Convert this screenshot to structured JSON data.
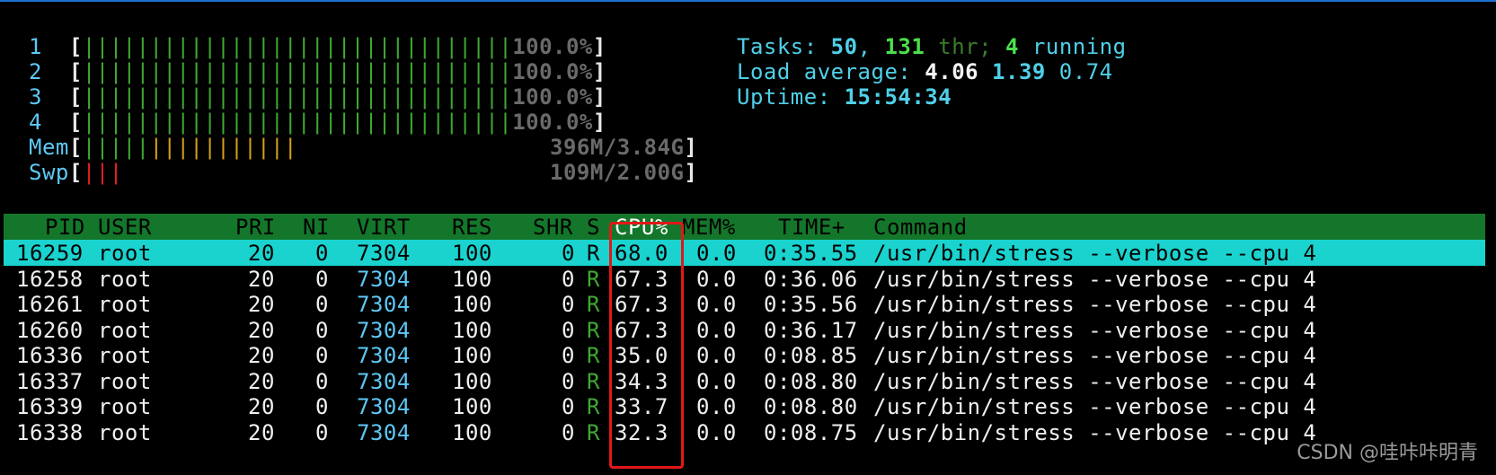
{
  "meters": {
    "cpu": [
      {
        "id": "1",
        "bars": "||||||||||||||||||||||||||||||||",
        "value": "100.0%"
      },
      {
        "id": "2",
        "bars": "||||||||||||||||||||||||||||||||",
        "value": "100.0%"
      },
      {
        "id": "3",
        "bars": "||||||||||||||||||||||||||||||||",
        "value": "100.0%"
      },
      {
        "id": "4",
        "bars": "||||||||||||||||||||||||||||||||",
        "value": "100.0%"
      }
    ],
    "mem": {
      "label": "Mem",
      "green_bars": "|||||",
      "orange_bars": "|||||||||||",
      "value": "396M/3.84G"
    },
    "swp": {
      "label": "Swp",
      "red_bars": "|||",
      "value": "109M/2.00G"
    },
    "open_bracket": "[",
    "close_bracket": "]"
  },
  "summary": {
    "tasks_label": "Tasks: ",
    "tasks": "50",
    "comma": ", ",
    "thr_count": "131",
    "thr_label": " thr; ",
    "running_count": "4",
    "running_label": " running",
    "load_label": "Load average: ",
    "load1": "4.06",
    "load5": "1.39",
    "load15": "0.74",
    "uptime_label": "Uptime: ",
    "uptime": "15:54:34"
  },
  "table": {
    "columns": [
      "PID",
      "USER",
      "PRI",
      "NI",
      "VIRT",
      "RES",
      "SHR",
      "S",
      "CPU%",
      "MEM%",
      "TIME+",
      "Command"
    ],
    "rows": [
      {
        "pid": "16259",
        "user": "root",
        "pri": "20",
        "ni": "0",
        "virt": "7304",
        "res": "100",
        "shr": "0",
        "s": "R",
        "cpu": "68.0",
        "mem": "0.0",
        "time": "0:35.55",
        "cmd": "/usr/bin/stress --verbose --cpu 4",
        "selected": true
      },
      {
        "pid": "16258",
        "user": "root",
        "pri": "20",
        "ni": "0",
        "virt": "7304",
        "res": "100",
        "shr": "0",
        "s": "R",
        "cpu": "67.3",
        "mem": "0.0",
        "time": "0:36.06",
        "cmd": "/usr/bin/stress --verbose --cpu 4"
      },
      {
        "pid": "16261",
        "user": "root",
        "pri": "20",
        "ni": "0",
        "virt": "7304",
        "res": "100",
        "shr": "0",
        "s": "R",
        "cpu": "67.3",
        "mem": "0.0",
        "time": "0:35.56",
        "cmd": "/usr/bin/stress --verbose --cpu 4"
      },
      {
        "pid": "16260",
        "user": "root",
        "pri": "20",
        "ni": "0",
        "virt": "7304",
        "res": "100",
        "shr": "0",
        "s": "R",
        "cpu": "67.3",
        "mem": "0.0",
        "time": "0:36.17",
        "cmd": "/usr/bin/stress --verbose --cpu 4"
      },
      {
        "pid": "16336",
        "user": "root",
        "pri": "20",
        "ni": "0",
        "virt": "7304",
        "res": "100",
        "shr": "0",
        "s": "R",
        "cpu": "35.0",
        "mem": "0.0",
        "time": "0:08.85",
        "cmd": "/usr/bin/stress --verbose --cpu 4"
      },
      {
        "pid": "16337",
        "user": "root",
        "pri": "20",
        "ni": "0",
        "virt": "7304",
        "res": "100",
        "shr": "0",
        "s": "R",
        "cpu": "34.3",
        "mem": "0.0",
        "time": "0:08.80",
        "cmd": "/usr/bin/stress --verbose --cpu 4"
      },
      {
        "pid": "16339",
        "user": "root",
        "pri": "20",
        "ni": "0",
        "virt": "7304",
        "res": "100",
        "shr": "0",
        "s": "R",
        "cpu": "33.7",
        "mem": "0.0",
        "time": "0:08.80",
        "cmd": "/usr/bin/stress --verbose --cpu 4"
      },
      {
        "pid": "16338",
        "user": "root",
        "pri": "20",
        "ni": "0",
        "virt": "7304",
        "res": "100",
        "shr": "0",
        "s": "R",
        "cpu": "32.3",
        "mem": "0.0",
        "time": "0:08.75",
        "cmd": "/usr/bin/stress --verbose --cpu 4"
      }
    ]
  },
  "watermark": "CSDN @哇咔咔明青",
  "colors": {
    "background": "#000000",
    "header_bar": "#14762a",
    "selected_row": "#1ad3cf",
    "highlight_box": "#e01818",
    "label_cyan": "#5ec8f5"
  }
}
